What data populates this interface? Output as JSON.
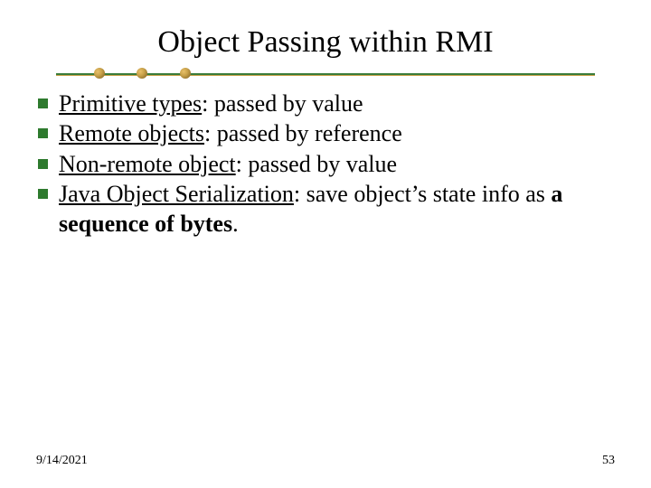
{
  "title": "Object Passing within RMI",
  "bullets": [
    {
      "lead": "Primitive types",
      "rest": ": passed by value"
    },
    {
      "lead": "Remote objects",
      "rest": ": passed by reference"
    },
    {
      "lead": "Non-remote object",
      "rest": ": passed by value"
    },
    {
      "lead": "Java Object Serialization",
      "rest": ": save object’s state info as ",
      "bold": "a sequence of bytes",
      "tail": "."
    }
  ],
  "footer": {
    "date": "9/14/2021",
    "page": "53"
  },
  "colors": {
    "accent": "#2e7a2e",
    "bead": "#c9a24a"
  }
}
